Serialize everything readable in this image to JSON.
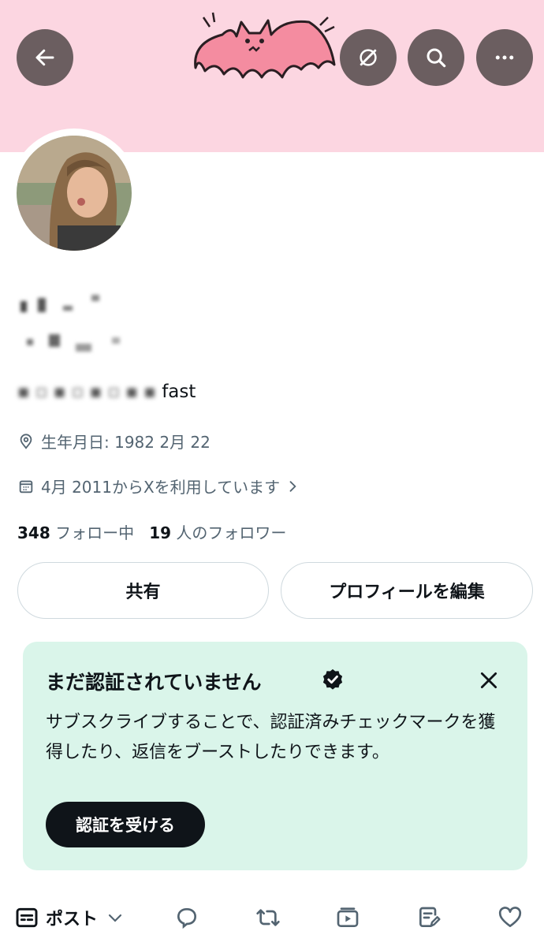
{
  "header": {
    "back_icon": "arrow-left-icon",
    "grok_icon": "slashed-circle-icon",
    "search_icon": "search-icon",
    "more_icon": "more-horizontal-icon",
    "banner_color": "#fcd6e1"
  },
  "profile": {
    "bio_suffix": "fast",
    "birthday": "生年月日: 1982 2月 22",
    "joined": "4月 2011からXを利用しています",
    "following_count": "348",
    "following_label": "フォロー中",
    "followers_count": "19",
    "followers_label": "人のフォロワー"
  },
  "actions": {
    "share_label": "共有",
    "edit_profile_label": "プロフィールを編集"
  },
  "verification": {
    "title": "まだ認証されていません",
    "body": "サブスクライブすることで、認証済みチェックマークを獲得したり、返信をブーストしたりできます。",
    "cta_label": "認証を受ける",
    "background": "#daf5ea"
  },
  "tabs": {
    "posts_label": "ポスト"
  }
}
